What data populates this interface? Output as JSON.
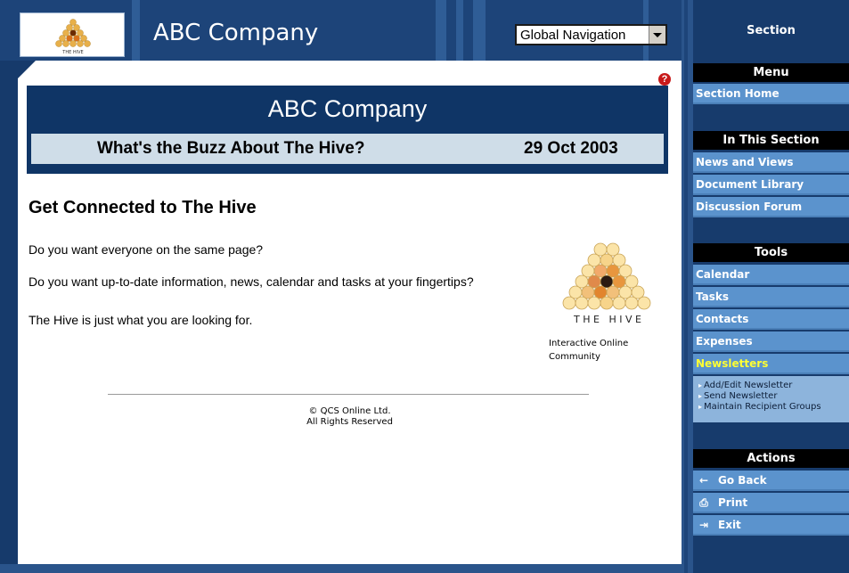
{
  "header": {
    "company_name": "ABC Company",
    "global_nav": {
      "selected": "Global Navigation"
    }
  },
  "main": {
    "banner_title": "ABC Company",
    "buzz_title": "What's the Buzz About The Hive?",
    "date": "29 Oct 2003",
    "heading": "Get Connected to The Hive",
    "paragraphs": [
      "Do you want everyone on the same page?",
      "Do you want up-to-date information, news, calendar and tasks at your fingertips?",
      "The Hive is just what you are looking for."
    ],
    "hive_logo_text": "T H E   H I V E",
    "hive_caption": [
      "Interactive Online",
      "Community"
    ],
    "footer": [
      "© QCS Online Ltd.",
      "All Rights Reserved"
    ]
  },
  "sidebar": {
    "section_title": "Section",
    "menu": {
      "heading": "Menu",
      "items": [
        "Section Home"
      ]
    },
    "in_this_section": {
      "heading": "In This Section",
      "items": [
        "News and Views",
        "Document Library",
        "Discussion Forum"
      ]
    },
    "tools": {
      "heading": "Tools",
      "items": [
        "Calendar",
        "Tasks",
        "Contacts",
        "Expenses",
        "Newsletters"
      ],
      "active": "Newsletters",
      "sub_items": [
        "Add/Edit Newsletter",
        "Send Newsletter",
        "Maintain Recipient Groups"
      ]
    },
    "actions": {
      "heading": "Actions",
      "items": [
        {
          "label": "Go Back",
          "icon": "back-arrow-icon"
        },
        {
          "label": "Print",
          "icon": "print-icon"
        },
        {
          "label": "Exit",
          "icon": "exit-door-icon"
        }
      ]
    }
  },
  "colors": {
    "frame": "#163a6b",
    "banner": "#0f3566",
    "buzz_bar": "#cfdde8",
    "link_bg": "#5b93cd",
    "active_link": "#ffff33",
    "help_icon": "#c81a1a"
  }
}
